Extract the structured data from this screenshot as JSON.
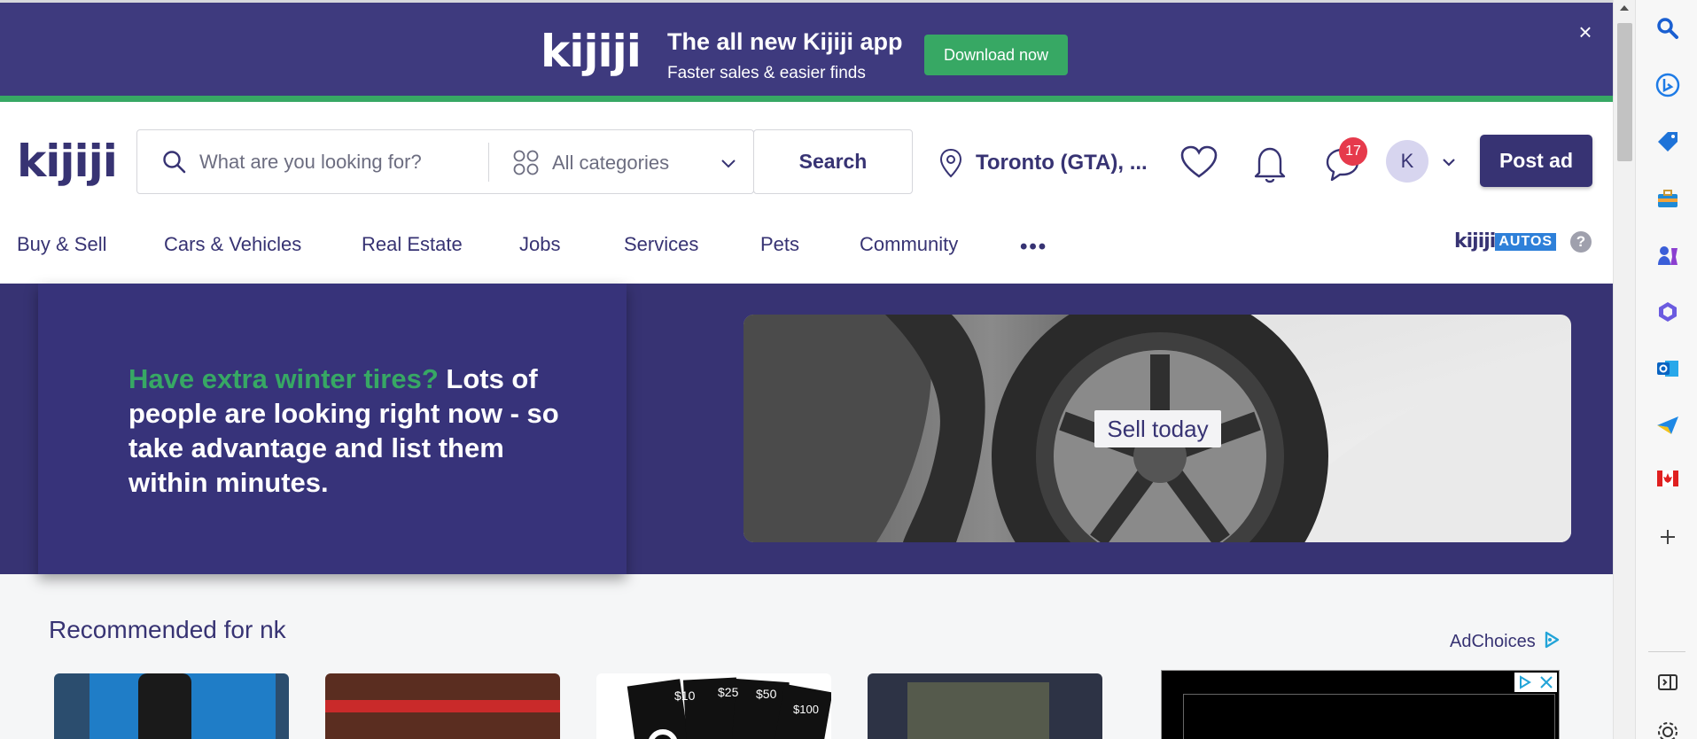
{
  "app_banner": {
    "logo": "kijiji",
    "title": "The all new Kijiji app",
    "subtitle": "Faster sales & easier finds",
    "download_label": "Download now",
    "close_label": "×"
  },
  "header": {
    "logo": "kijiji",
    "search_placeholder": "What are you looking for?",
    "category_label": "All categories",
    "search_button": "Search",
    "location_label": "Toronto (GTA), ...",
    "chat_badge": "17",
    "avatar_initial": "K",
    "post_ad_label": "Post ad"
  },
  "nav": {
    "items": [
      "Buy & Sell",
      "Cars & Vehicles",
      "Real Estate",
      "Jobs",
      "Services",
      "Pets",
      "Community"
    ],
    "more_label": "•••",
    "autos_logo_kijiji": "kijiji",
    "autos_logo_autos": "AUTOS",
    "help_label": "?"
  },
  "hero": {
    "highlight": "Have extra winter tires?",
    "text": " Lots of people are looking right now - so take advantage and list them within minutes.",
    "cta": "Sell today"
  },
  "recommended": {
    "title": "Recommended for nk",
    "adchoices": "AdChoices",
    "price_tags": [
      "$10",
      "$25",
      "$50",
      "$100"
    ]
  },
  "colors": {
    "brand_purple": "#373373",
    "brand_green": "#37a864",
    "badge_red": "#e63a4c"
  }
}
